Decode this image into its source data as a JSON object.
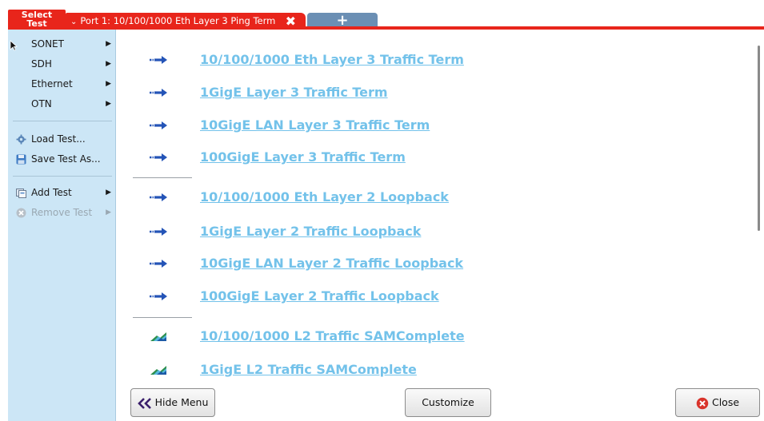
{
  "tabs": {
    "select_test": [
      "Select",
      "Test"
    ],
    "port_tab_label": "Port 1: 10/100/1000 Eth Layer 3 Ping Term",
    "add_tab_label": "+"
  },
  "menu": {
    "items": [
      {
        "label": "SONET",
        "submenu": true
      },
      {
        "label": "SDH",
        "submenu": true
      },
      {
        "label": "Ethernet",
        "submenu": true
      },
      {
        "label": "OTN",
        "submenu": true
      },
      {
        "label": "Load Test...",
        "icon": "gear-icon"
      },
      {
        "label": "Save Test As...",
        "icon": "save-icon"
      },
      {
        "label": "Add Test",
        "icon": "add-test-icon",
        "submenu": true
      },
      {
        "label": "Remove Test",
        "icon": "remove-icon",
        "submenu": true,
        "disabled": true
      }
    ]
  },
  "tests": [
    {
      "label": "10/100/1000 Eth Layer 3 Traffic Term",
      "icon": "arrow-icon"
    },
    {
      "label": "1GigE Layer 3 Traffic Term",
      "icon": "arrow-icon"
    },
    {
      "label": "10GigE LAN Layer 3 Traffic Term",
      "icon": "arrow-icon"
    },
    {
      "label": "100GigE Layer 3 Traffic Term",
      "icon": "arrow-icon"
    },
    {
      "label": "10/100/1000 Eth Layer 2 Loopback",
      "icon": "arrow-icon"
    },
    {
      "label": "1GigE Layer 2 Traffic Loopback",
      "icon": "arrow-icon"
    },
    {
      "label": "10GigE LAN Layer 2 Traffic Loopback",
      "icon": "arrow-icon"
    },
    {
      "label": "100GigE Layer 2 Traffic Loopback",
      "icon": "arrow-icon"
    },
    {
      "label": "10/100/1000 L2 Traffic SAMComplete",
      "icon": "samcomplete-icon"
    },
    {
      "label": "1GigE L2 Traffic SAMComplete",
      "icon": "samcomplete-icon"
    }
  ],
  "buttons": {
    "hide_menu": "Hide Menu",
    "customize": "Customize",
    "close": "Close"
  },
  "colors": {
    "accent_red": "#e8251b",
    "menu_bg": "#cce6f6",
    "link": "#73c2ea"
  }
}
